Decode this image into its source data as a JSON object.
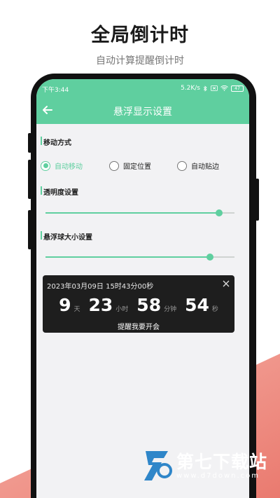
{
  "promo": {
    "title": "全局倒计时",
    "subtitle": "自动计算提醒倒计时"
  },
  "status_bar": {
    "time": "下午3:44",
    "speed": "5.2K/s",
    "battery": "47"
  },
  "app_bar": {
    "title": "悬浮显示设置",
    "back_icon": "arrow-left-icon"
  },
  "move_mode": {
    "label": "移动方式",
    "options": [
      {
        "label": "自动移动",
        "selected": true
      },
      {
        "label": "固定位置",
        "selected": false
      },
      {
        "label": "自动贴边",
        "selected": false
      }
    ]
  },
  "opacity": {
    "label": "透明度设置",
    "value": 0.92
  },
  "ball_size": {
    "label": "悬浮球大小设置",
    "value": 0.87
  },
  "timer": {
    "date": "2023年03月09日 15时43分00秒",
    "days": "9",
    "days_unit": "天",
    "hours": "23",
    "hours_unit": "小时",
    "minutes": "58",
    "minutes_unit": "分钟",
    "seconds": "54",
    "seconds_unit": "秒",
    "message": "提醒我要开会"
  },
  "watermark": {
    "name": "第七下载站",
    "url": "www.d7down.com"
  },
  "colors": {
    "accent": "#5fcf9f",
    "wedge": "#ef8a7e",
    "card": "#1e1e1e"
  }
}
